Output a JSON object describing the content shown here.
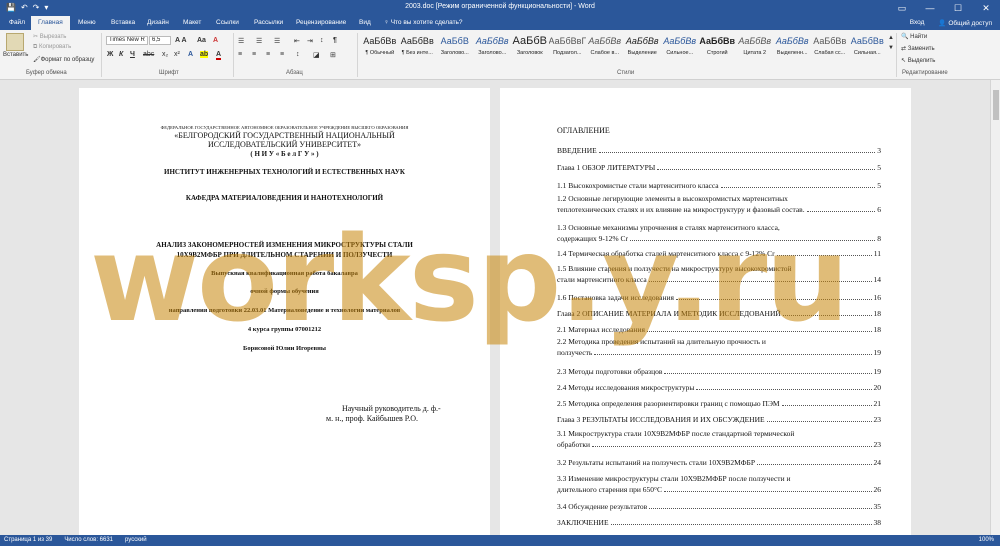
{
  "window": {
    "title": "2003.doc [Режим ограниченной функциональности] - Word",
    "controls": [
      "▭",
      "—",
      "☐",
      "✕"
    ]
  },
  "menu": {
    "file": "Файл",
    "home": "Главная",
    "insert": "Меню",
    "insert2": "Вставка",
    "design": "Дизайн",
    "layout": "Макет",
    "refs": "Ссылки",
    "mailings": "Рассылки",
    "review": "Рецензирование",
    "view": "Вид",
    "tell_me": "Что вы хотите сделать?",
    "signin": "Вход",
    "share": "Общий доступ"
  },
  "ribbon": {
    "paste": "Вставить",
    "cut": "Вырезать",
    "copy": "Копировать",
    "format_painter": "Формат по образцу",
    "clipboard": "Буфер обмена",
    "font_name": "Times New R",
    "font_size": "6,5",
    "font_group": "Шрифт",
    "paragraph_group": "Абзац",
    "styles_group": "Стили",
    "find": "Найти",
    "replace": "Заменить",
    "select": "Выделить",
    "editing_group": "Редактирование",
    "styles": [
      {
        "sample": "АаБбВв",
        "name": "¶ Обычный"
      },
      {
        "sample": "АаБбВв",
        "name": "¶ Без инте..."
      },
      {
        "sample": "АаБбВ",
        "name": "Заголово..."
      },
      {
        "sample": "АаБбВв",
        "name": "Заголово..."
      },
      {
        "sample": "АаБбВ",
        "name": "Заголовок"
      },
      {
        "sample": "АаБбВвГ",
        "name": "Подзагол..."
      },
      {
        "sample": "АаБбВв",
        "name": "Слабое в..."
      },
      {
        "sample": "АаБбВв",
        "name": "Выделение"
      },
      {
        "sample": "АаБбВв",
        "name": "Сильное..."
      },
      {
        "sample": "АаБбВв",
        "name": "Строгий"
      },
      {
        "sample": "АаБбВв",
        "name": "Цитата 2"
      },
      {
        "sample": "АаБбВв",
        "name": "Выделенн..."
      },
      {
        "sample": "АаБбВв",
        "name": "Слабая сс..."
      },
      {
        "sample": "АаБбВв",
        "name": "Сильная..."
      }
    ]
  },
  "page1": {
    "org": "ФЕДЕРАЛЬНОЕ ГОСУДАРСТВЕННОЕ АВТОНОМНОЕ ОБРАЗОВАТЕЛЬНОЕ УЧРЕЖДЕНИЕ ВЫСШЕГО ОБРАЗОВАНИЯ",
    "univ1": "«БЕЛГОРОДСКИЙ ГОСУДАРСТВЕННЫЙ НАЦИОНАЛЬНЫЙ",
    "univ2": "ИССЛЕДОВАТЕЛЬСКИЙ УНИВЕРСИТЕТ»",
    "univ3": "( Н И У  «  Б е л Г У  » )",
    "institute": "ИНСТИТУТ ИНЖЕНЕРНЫХ ТЕХНОЛОГИЙ И ЕСТЕСТВЕННЫХ НАУК",
    "department": "КАФЕДРА МАТЕРИАЛОВЕДЕНИЯ И НАНОТЕХНОЛОГИЙ",
    "topic1": "АНАЛИЗ ЗАКОНОМЕРНОСТЕЙ ИЗМЕНЕНИЯ МИКРОСТРУКТУРЫ СТАЛИ",
    "topic2": "10Х9В2МФБР ПРИ ДЛИТЕЛЬНОМ СТАРЕНИИ И ПОЛЗУЧЕСТИ",
    "work_type": "Выпускная квалификационная работа бакалавра",
    "form": "очной формы обучения",
    "direction": "направления подготовки 22.03.01 Материаловедение и технологии материалов",
    "course": "4  курса группы 07001212",
    "author": "Борисовой Юлии Игоревны",
    "supervisor1": "Научный руководитель д. ф.-",
    "supervisor2": "м. н., проф. Кайбышев Р.О."
  },
  "toc": {
    "heading": "ОГЛАВЛЕНИЕ",
    "items": [
      {
        "text": "ВВЕДЕНИЕ",
        "page": "3"
      },
      {
        "text": "Глава 1 ОБЗОР ЛИТЕРАТУРЫ",
        "page": "5"
      },
      {
        "text": "1.1  Высокохромистые стали мартенситного класса",
        "page": "5"
      },
      {
        "text": "1.2  Основные легирующие элементы в высокохромистых мартенситных",
        "text2": "теплотехнических сталях и их влияние на микроструктуру и фазовый состав.",
        "page": "6"
      },
      {
        "text": "1.3  Основные механизмы упрочнения в сталях мартенситного класса,",
        "text2": "содержащих 9-12% Cr",
        "page": "8"
      },
      {
        "text": "1.4  Термическая обработка сталей мартенситного класса с 9-12% Cr",
        "page": "11"
      },
      {
        "text": "1.5  Влияние старения и ползучести на микроструктуру высокохромистой",
        "text2": "стали мартенситного класса",
        "page": "14"
      },
      {
        "text": "1.6  Постановка задачи исследования",
        "page": "16"
      },
      {
        "text": "Глава 2 ОПИСАНИЕ МАТЕРИАЛА И МЕТОДИК ИССЛЕДОВАНИЙ",
        "page": "18"
      },
      {
        "text": "2.1  Материал исследования",
        "page": "18"
      },
      {
        "text": "2.2  Методика проведения испытаний на длительную прочность и",
        "text2": "ползучесть",
        "page": "19"
      },
      {
        "text": "2.3  Методы подготовки образцов",
        "page": "19"
      },
      {
        "text": "2.4  Методы исследования микроструктуры",
        "page": "20"
      },
      {
        "text": "2.5  Методика определения разориентировки границ с помощью ПЭМ",
        "page": "21"
      },
      {
        "text": "Глава 3 РЕЗУЛЬТАТЫ ИССЛЕДОВАНИЯ И ИХ ОБСУЖДЕНИЕ",
        "page": "23"
      },
      {
        "text": "3.1  Микроструктура стали 10Х9В2МФБР после стандартной термической",
        "text2": "обработки",
        "page": "23"
      },
      {
        "text": "3.2  Результаты испытаний на ползучесть стали 10Х9В2МФБР",
        "page": "24"
      },
      {
        "text": "3.3  Изменение микроструктуры стали 10Х9В2МФБР после ползучести и",
        "text2": "длительного старения при 650°C",
        "page": "26"
      },
      {
        "text": "3.4  Обсуждение результатов",
        "page": "35"
      },
      {
        "text": "ЗАКЛЮЧЕНИЕ",
        "page": "38"
      }
    ]
  },
  "watermark": "worksp.y.ru",
  "status": {
    "page": "Страница 1 из 39",
    "words": "Число слов: 6631",
    "lang": "русский",
    "zoom": "100%"
  }
}
